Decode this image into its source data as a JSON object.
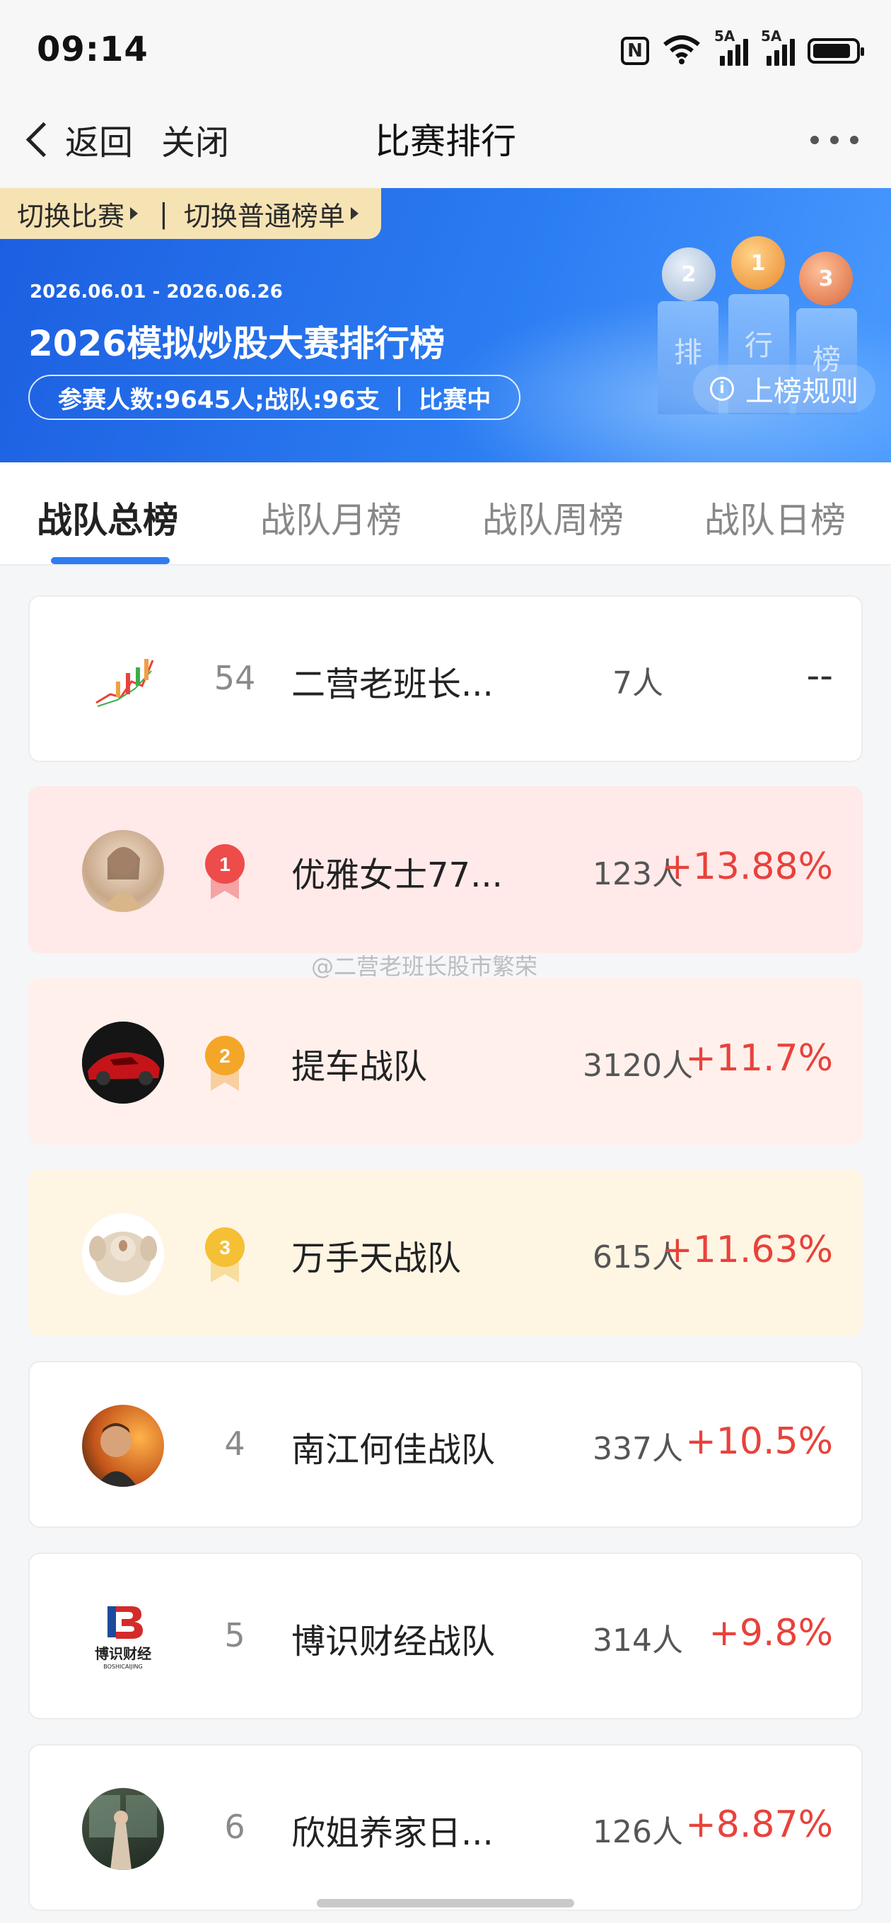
{
  "status_bar": {
    "time": "09:14",
    "nfc": "N",
    "signal1_label": "5A",
    "signal2_label": "5A",
    "wifi_label": "6",
    "battery_level": 0.9
  },
  "nav": {
    "back_label": "返回",
    "close_label": "关闭",
    "title": "比赛排行"
  },
  "banner": {
    "switch_contest": "切换比赛",
    "separator": "|",
    "switch_normal": "切换普通榜单",
    "dates": "2026.06.01 - 2026.06.26",
    "title": "2026模拟炒股大赛排行榜",
    "participants": "参赛人数:9645人;战队:96支",
    "status": "比赛中",
    "rules_label": "上榜规则",
    "podium": [
      "排",
      "行",
      "榜"
    ]
  },
  "tabs": [
    {
      "label": "战队总榜",
      "active": true
    },
    {
      "label": "战队月榜",
      "active": false
    },
    {
      "label": "战队周榜",
      "active": false
    },
    {
      "label": "战队日榜",
      "active": false
    }
  ],
  "my_team": {
    "rank": "54",
    "name": "二营老班长...",
    "members": "7人",
    "return": "--"
  },
  "teams": [
    {
      "rank": "1",
      "name": "优雅女士77...",
      "members": "123人",
      "return": "+13.88%"
    },
    {
      "rank": "2",
      "name": "提车战队",
      "members": "3120人",
      "return": "+11.7%"
    },
    {
      "rank": "3",
      "name": "万手天战队",
      "members": "615人",
      "return": "+11.63%"
    },
    {
      "rank": "4",
      "name": "南江何佳战队",
      "members": "337人",
      "return": "+10.5%"
    },
    {
      "rank": "5",
      "name": "博识财经战队",
      "members": "314人",
      "return": "+9.8%"
    },
    {
      "rank": "6",
      "name": "欣姐养家日...",
      "members": "126人",
      "return": "+8.87%"
    }
  ],
  "logo_text": {
    "brand_cn": "博识财经",
    "brand_en": "BOSHICAIJING"
  },
  "watermark": "@二营老班长股市繁荣",
  "colors": {
    "accent": "#2f7cf0",
    "gain": "#e8423b",
    "gold": "#f6e3b4"
  }
}
